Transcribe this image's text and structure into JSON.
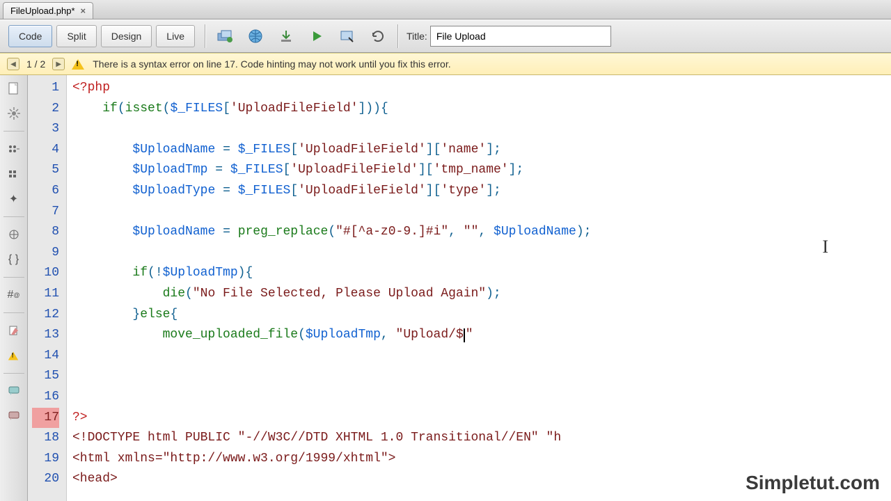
{
  "tab": {
    "filename": "FileUpload.php*",
    "close_glyph": "×"
  },
  "toolbar": {
    "view_buttons": {
      "code": "Code",
      "split": "Split",
      "design": "Design",
      "live": "Live"
    },
    "title_label": "Title:",
    "title_value": "File Upload"
  },
  "errorbar": {
    "prev_glyph": "◀",
    "next_glyph": "▶",
    "counter": "1 / 2",
    "message": "There is a syntax error on line 17.  Code hinting may not work until you fix this error."
  },
  "gutter": {
    "lines": [
      1,
      2,
      3,
      4,
      5,
      6,
      7,
      8,
      9,
      10,
      11,
      12,
      13,
      14,
      15,
      16,
      17,
      18,
      19,
      20
    ],
    "error_line": 17
  },
  "code": {
    "lines_html": [
      "<span class='k-tag'>&lt;?php</span>",
      "    <span class='k-kw'>if</span><span class='k-punc'>(</span><span class='k-func'>isset</span><span class='k-punc'>(</span><span class='k-var'>$_FILES</span><span class='k-punc'>[</span><span class='k-str'>'UploadFileField'</span><span class='k-punc'>])){</span>",
      "",
      "        <span class='k-var'>$UploadName</span> <span class='k-punc'>=</span> <span class='k-var'>$_FILES</span><span class='k-punc'>[</span><span class='k-str'>'UploadFileField'</span><span class='k-punc'>][</span><span class='k-str'>'name'</span><span class='k-punc'>];</span>",
      "        <span class='k-var'>$UploadTmp</span> <span class='k-punc'>=</span> <span class='k-var'>$_FILES</span><span class='k-punc'>[</span><span class='k-str'>'UploadFileField'</span><span class='k-punc'>][</span><span class='k-str'>'tmp_name'</span><span class='k-punc'>];</span>",
      "        <span class='k-var'>$UploadType</span> <span class='k-punc'>=</span> <span class='k-var'>$_FILES</span><span class='k-punc'>[</span><span class='k-str'>'UploadFileField'</span><span class='k-punc'>][</span><span class='k-str'>'type'</span><span class='k-punc'>];</span>",
      "",
      "        <span class='k-var'>$UploadName</span> <span class='k-punc'>=</span> <span class='k-func'>preg_replace</span><span class='k-punc'>(</span><span class='k-str'>\"#[^a-z0-9.]#i\"</span><span class='k-punc'>,</span> <span class='k-str'>\"\"</span><span class='k-punc'>,</span> <span class='k-var'>$UploadName</span><span class='k-punc'>);</span>",
      "",
      "        <span class='k-kw'>if</span><span class='k-punc'>(!</span><span class='k-var'>$UploadTmp</span><span class='k-punc'>){</span>",
      "            <span class='k-func'>die</span><span class='k-punc'>(</span><span class='k-str'>\"No File Selected, Please Upload Again\"</span><span class='k-punc'>);</span>",
      "        <span class='k-punc'>}</span><span class='k-kw'>else</span><span class='k-punc'>{</span>",
      "            <span class='k-func'>move_uploaded_file</span><span class='k-punc'>(</span><span class='k-var'>$UploadTmp</span><span class='k-punc'>,</span> <span class='k-str'>\"Upload/$</span><span class='cursor'></span><span class='k-str'>\"</span>",
      "",
      "",
      "",
      "<span class='k-tag'>?&gt;</span>",
      "<span class='k-html'>&lt;!DOCTYPE html PUBLIC \"-//W3C//DTD XHTML 1.0 Transitional//EN\" \"h</span>",
      "<span class='k-html'>&lt;html xmlns=\"http://www.w3.org/1999/xhtml\"&gt;</span>",
      "<span class='k-html'>&lt;head&gt;</span>"
    ]
  },
  "watermark": "Simpletut.com",
  "sidebar_icons": [
    "doc-icon",
    "gear-icon",
    "dots1-icon",
    "dots2-icon",
    "star-icon",
    "globe-icon",
    "braces-icon",
    "hash-icon",
    "edit-icon",
    "warn-icon",
    "chat-icon",
    "tag-icon"
  ]
}
